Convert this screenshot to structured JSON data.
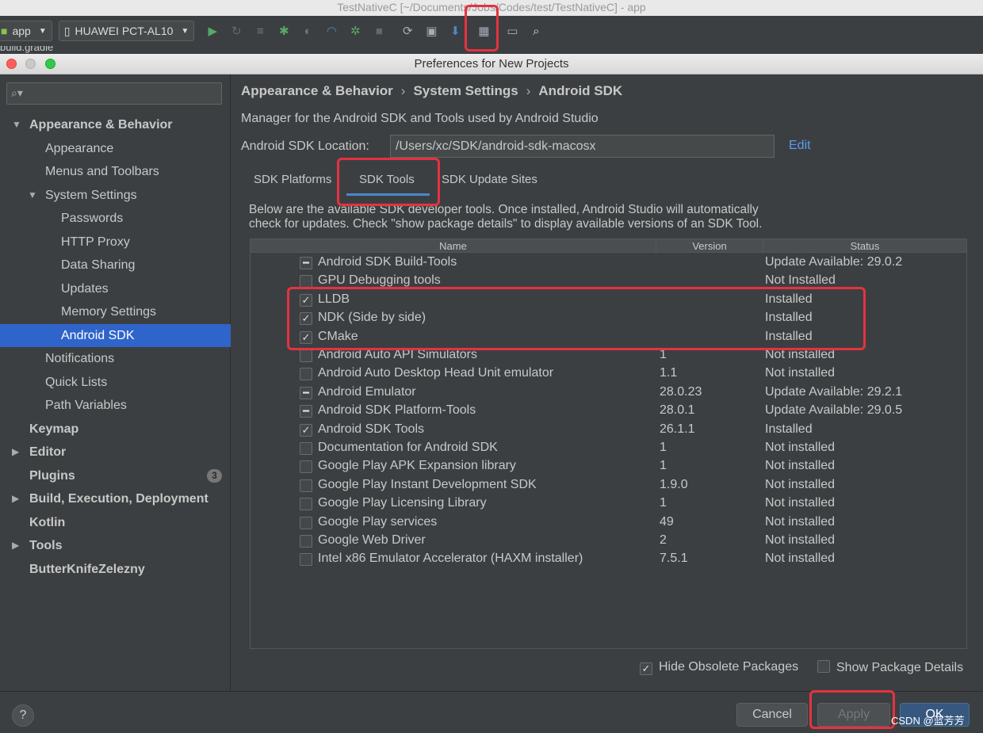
{
  "ide_title": "TestNativeC [~/Documents/Jobs/Codes/test/TestNativeC] - app",
  "toolbar": {
    "module_label": "app",
    "device_label": "HUAWEI PCT-AL10"
  },
  "strip_text": "build.gradle",
  "dialog": {
    "title": "Preferences for New Projects"
  },
  "sidebar": {
    "items": [
      {
        "label": "Appearance & Behavior"
      },
      {
        "label": "Appearance"
      },
      {
        "label": "Menus and Toolbars"
      },
      {
        "label": "System Settings"
      },
      {
        "label": "Passwords"
      },
      {
        "label": "HTTP Proxy"
      },
      {
        "label": "Data Sharing"
      },
      {
        "label": "Updates"
      },
      {
        "label": "Memory Settings"
      },
      {
        "label": "Android SDK"
      },
      {
        "label": "Notifications"
      },
      {
        "label": "Quick Lists"
      },
      {
        "label": "Path Variables"
      },
      {
        "label": "Keymap"
      },
      {
        "label": "Editor"
      },
      {
        "label": "Plugins"
      },
      {
        "label": "Build, Execution, Deployment"
      },
      {
        "label": "Kotlin"
      },
      {
        "label": "Tools"
      },
      {
        "label": "ButterKnifeZelezny"
      }
    ],
    "plugins_badge": "3"
  },
  "breadcrumb": [
    "Appearance & Behavior",
    "System Settings",
    "Android SDK"
  ],
  "description": "Manager for the Android SDK and Tools used by Android Studio",
  "sdk_location": {
    "label": "Android SDK Location:",
    "value": "/Users/xc/SDK/android-sdk-macosx",
    "edit": "Edit"
  },
  "tabs": [
    "SDK Platforms",
    "SDK Tools",
    "SDK Update Sites"
  ],
  "note_line1": "Below are the available SDK developer tools. Once installed, Android Studio will automatically",
  "note_line2": "check for updates. Check \"show package details\" to display available versions of an SDK Tool.",
  "table": {
    "headers": [
      "Name",
      "Version",
      "Status"
    ],
    "rows": [
      {
        "state": "partial",
        "name": "Android SDK Build-Tools",
        "version": "",
        "status": "Update Available: 29.0.2"
      },
      {
        "state": "unchecked",
        "name": "GPU Debugging tools",
        "version": "",
        "status": "Not Installed"
      },
      {
        "state": "checked",
        "name": "LLDB",
        "version": "",
        "status": "Installed"
      },
      {
        "state": "checked",
        "name": "NDK (Side by side)",
        "version": "",
        "status": "Installed"
      },
      {
        "state": "checked",
        "name": "CMake",
        "version": "",
        "status": "Installed"
      },
      {
        "state": "unchecked",
        "name": "Android Auto API Simulators",
        "version": "1",
        "status": "Not installed"
      },
      {
        "state": "unchecked",
        "name": "Android Auto Desktop Head Unit emulator",
        "version": "1.1",
        "status": "Not installed"
      },
      {
        "state": "partial",
        "name": "Android Emulator",
        "version": "28.0.23",
        "status": "Update Available: 29.2.1"
      },
      {
        "state": "partial",
        "name": "Android SDK Platform-Tools",
        "version": "28.0.1",
        "status": "Update Available: 29.0.5"
      },
      {
        "state": "checked",
        "name": "Android SDK Tools",
        "version": "26.1.1",
        "status": "Installed"
      },
      {
        "state": "unchecked",
        "name": "Documentation for Android SDK",
        "version": "1",
        "status": "Not installed"
      },
      {
        "state": "unchecked",
        "name": "Google Play APK Expansion library",
        "version": "1",
        "status": "Not installed"
      },
      {
        "state": "unchecked",
        "name": "Google Play Instant Development SDK",
        "version": "1.9.0",
        "status": "Not installed"
      },
      {
        "state": "unchecked",
        "name": "Google Play Licensing Library",
        "version": "1",
        "status": "Not installed"
      },
      {
        "state": "unchecked",
        "name": "Google Play services",
        "version": "49",
        "status": "Not installed"
      },
      {
        "state": "unchecked",
        "name": "Google Web Driver",
        "version": "2",
        "status": "Not installed"
      },
      {
        "state": "unchecked",
        "name": "Intel x86 Emulator Accelerator (HAXM installer)",
        "version": "7.5.1",
        "status": "Not installed"
      }
    ]
  },
  "options": {
    "hide_obsolete": {
      "label": "Hide Obsolete Packages",
      "checked": true
    },
    "show_details": {
      "label": "Show Package Details",
      "checked": false
    }
  },
  "buttons": {
    "help": "?",
    "cancel": "Cancel",
    "apply": "Apply",
    "ok": "OK"
  },
  "watermark": "CSDN @蓝芳芳",
  "colors": {
    "selection": "#2f65ca",
    "highlight": "#e53240",
    "link": "#589df6",
    "ok_button": "#365880"
  }
}
